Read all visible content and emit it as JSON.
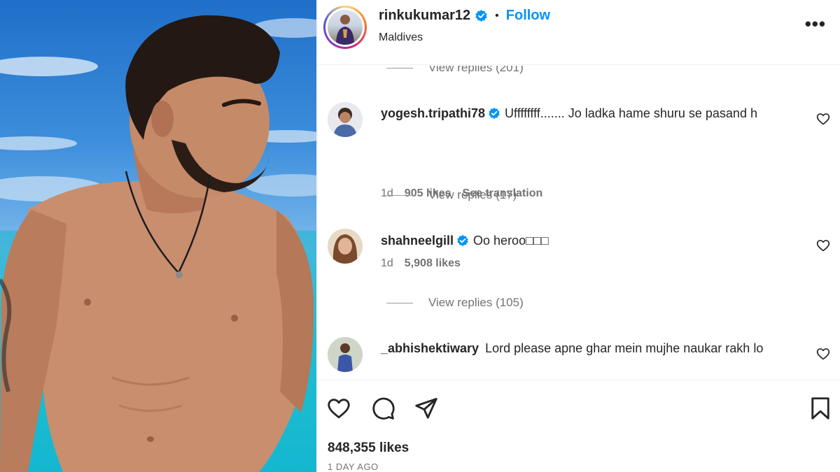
{
  "post": {
    "username": "rinkukumar12",
    "follow_label": "Follow",
    "separator": "•",
    "location": "Maldives",
    "more_label": "•••",
    "likes": "848,355 likes",
    "timestamp": "1 DAY AGO"
  },
  "comments": [
    {
      "replies_label": "View replies (201)"
    },
    {
      "username": "yogesh.tripathi78",
      "verified": true,
      "text": "Uffffffff....... Jo ladka hame shuru se pasand h",
      "age": "1d",
      "likes": "905 likes",
      "translation_label": "See translation",
      "replies_label": "View replies (17)"
    },
    {
      "username": "shahneelgill",
      "verified": true,
      "text": "Oo heroo□□□",
      "age": "1d",
      "likes": "5,908 likes",
      "replies_label": "View replies (105)"
    },
    {
      "username": "_abhishektiwary",
      "verified": false,
      "text": "Lord please apne ghar mein mujhe naukar rakh lo"
    }
  ],
  "icons": {
    "like": "heart-icon",
    "comment": "comment-icon",
    "share": "send-icon",
    "save": "bookmark-icon",
    "verified": "verified-badge-icon",
    "comment_like": "heart-outline-icon"
  },
  "colors": {
    "accent": "#0095f6",
    "text": "#262626",
    "secondary": "#737373"
  }
}
